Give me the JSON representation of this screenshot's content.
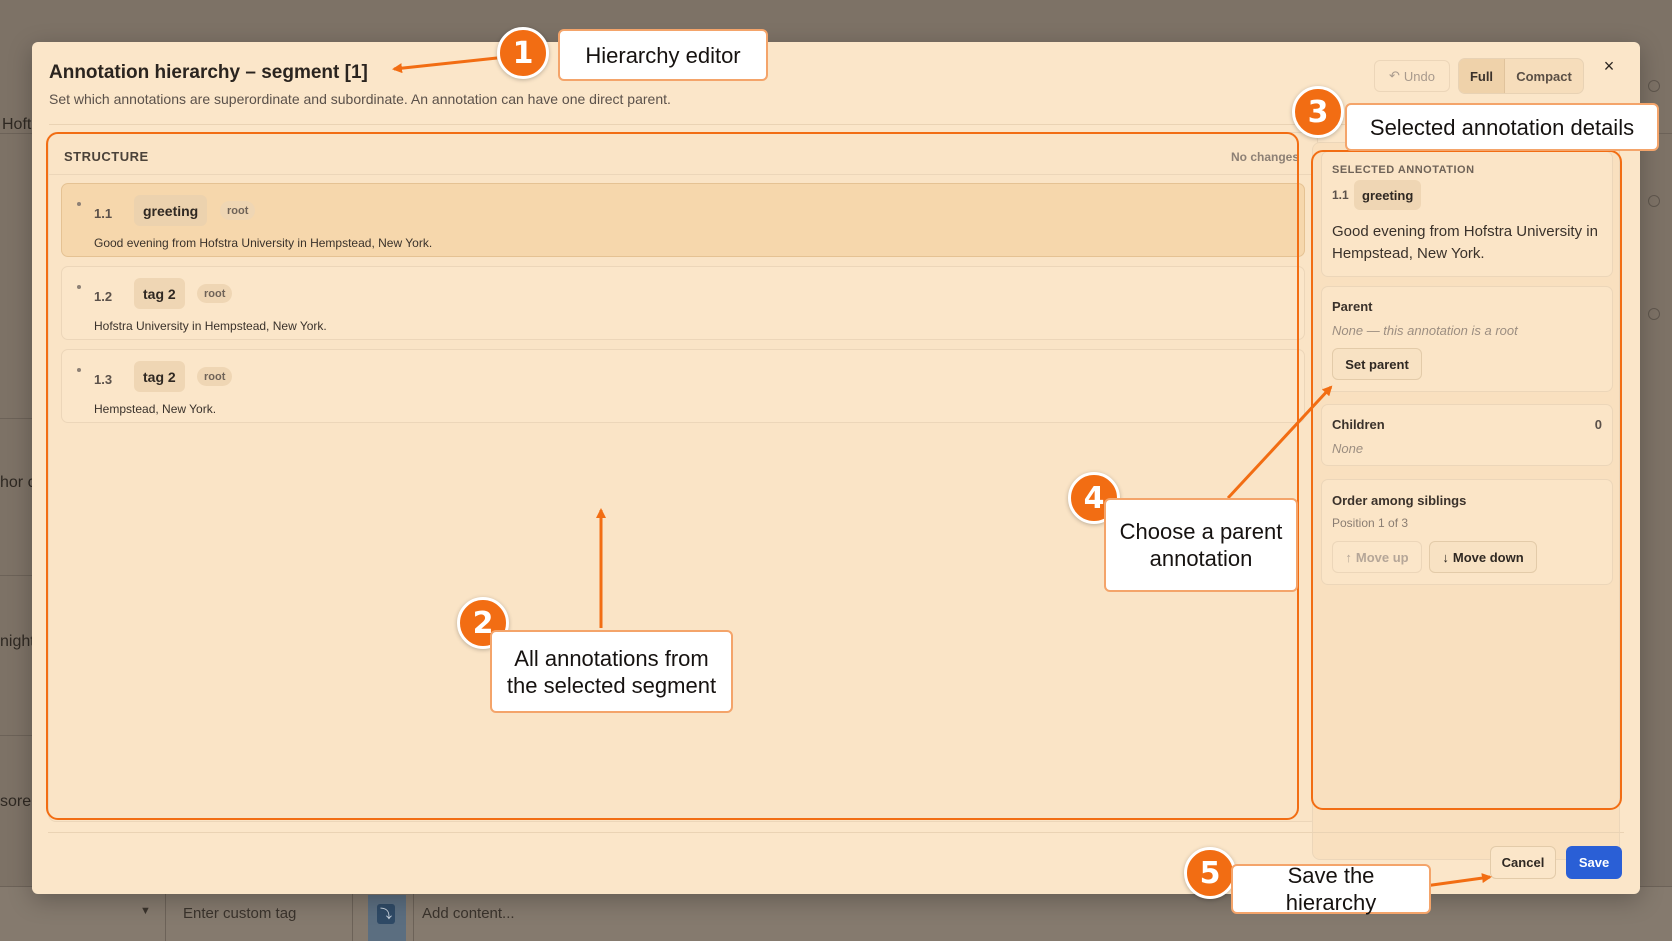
{
  "background": {
    "fragments": [
      "Hoft",
      "hor c",
      "night",
      "sore"
    ],
    "custom_tag_placeholder": "Enter custom tag",
    "content_placeholder": "Add content..."
  },
  "modal": {
    "title": "Annotation hierarchy – segment [1]",
    "subtitle": "Set which annotations are superordinate and subordinate. An annotation can have one direct parent.",
    "undo_label": "Undo",
    "view_full_label": "Full",
    "view_compact_label": "Compact",
    "close_label": "×"
  },
  "structure": {
    "heading": "STRUCTURE",
    "status": "No changes",
    "annotations": [
      {
        "number": "1.1",
        "tag": "greeting",
        "badge": "root",
        "text": "Good evening from Hofstra University in Hempstead, New York.",
        "selected": true
      },
      {
        "number": "1.2",
        "tag": "tag 2",
        "badge": "root",
        "text": "Hofstra University in Hempstead, New York.",
        "selected": false
      },
      {
        "number": "1.3",
        "tag": "tag 2",
        "badge": "root",
        "text": "Hempstead, New York.",
        "selected": false
      }
    ]
  },
  "details": {
    "selected_caption": "SELECTED ANNOTATION",
    "selected_number": "1.1",
    "selected_tag": "greeting",
    "selected_text": "Good evening from Hofstra University in Hempstead, New York.",
    "parent_heading": "Parent",
    "parent_value": "None — this annotation is a root",
    "set_parent_label": "Set parent",
    "children_heading": "Children",
    "children_count": "0",
    "children_value": "None",
    "order_heading": "Order among siblings",
    "order_value": "Position 1 of 3",
    "move_up_label": "Move up",
    "move_down_label": "Move down"
  },
  "footer": {
    "cancel_label": "Cancel",
    "save_label": "Save"
  },
  "callouts": [
    {
      "number": "1",
      "text": "Hierarchy editor"
    },
    {
      "number": "2",
      "text": "All annotations from the selected segment"
    },
    {
      "number": "3",
      "text": "Selected annotation details"
    },
    {
      "number": "4",
      "text": "Choose a parent annotation"
    },
    {
      "number": "5",
      "text": "Save the hierarchy"
    }
  ],
  "colors": {
    "accent": "#f26d13",
    "primary_button": "#2a5fd6",
    "modal_background": "#fbe6c9"
  }
}
